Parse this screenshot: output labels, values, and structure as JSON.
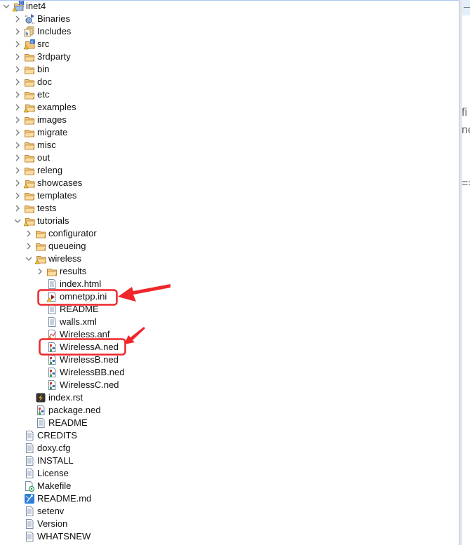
{
  "tree": [
    {
      "label": "inet4",
      "level": 0,
      "expander": "open",
      "icon": "project"
    },
    {
      "label": "Binaries",
      "level": 1,
      "expander": "closed",
      "icon": "binaries"
    },
    {
      "label": "Includes",
      "level": 1,
      "expander": "closed",
      "icon": "includes"
    },
    {
      "label": "src",
      "level": 1,
      "expander": "closed",
      "icon": "src-folder"
    },
    {
      "label": "3rdparty",
      "level": 1,
      "expander": "closed",
      "icon": "folder"
    },
    {
      "label": "bin",
      "level": 1,
      "expander": "closed",
      "icon": "folder"
    },
    {
      "label": "doc",
      "level": 1,
      "expander": "closed",
      "icon": "folder"
    },
    {
      "label": "etc",
      "level": 1,
      "expander": "closed",
      "icon": "folder"
    },
    {
      "label": "examples",
      "level": 1,
      "expander": "closed",
      "icon": "folder-warning"
    },
    {
      "label": "images",
      "level": 1,
      "expander": "closed",
      "icon": "folder"
    },
    {
      "label": "migrate",
      "level": 1,
      "expander": "closed",
      "icon": "folder"
    },
    {
      "label": "misc",
      "level": 1,
      "expander": "closed",
      "icon": "folder"
    },
    {
      "label": "out",
      "level": 1,
      "expander": "closed",
      "icon": "folder"
    },
    {
      "label": "releng",
      "level": 1,
      "expander": "closed",
      "icon": "folder"
    },
    {
      "label": "showcases",
      "level": 1,
      "expander": "closed",
      "icon": "folder-warning"
    },
    {
      "label": "templates",
      "level": 1,
      "expander": "closed",
      "icon": "folder"
    },
    {
      "label": "tests",
      "level": 1,
      "expander": "closed",
      "icon": "folder"
    },
    {
      "label": "tutorials",
      "level": 1,
      "expander": "open",
      "icon": "folder-warning"
    },
    {
      "label": "configurator",
      "level": 2,
      "expander": "closed",
      "icon": "folder"
    },
    {
      "label": "queueing",
      "level": 2,
      "expander": "closed",
      "icon": "folder"
    },
    {
      "label": "wireless",
      "level": 2,
      "expander": "open",
      "icon": "folder-warning"
    },
    {
      "label": "results",
      "level": 3,
      "expander": "closed",
      "icon": "folder"
    },
    {
      "label": "index.html",
      "level": 3,
      "expander": "none",
      "icon": "text-file"
    },
    {
      "label": "omnetpp.ini",
      "level": 3,
      "expander": "none",
      "icon": "ini-file",
      "highlighted": true
    },
    {
      "label": "README",
      "level": 3,
      "expander": "none",
      "icon": "text-file"
    },
    {
      "label": "walls.xml",
      "level": 3,
      "expander": "none",
      "icon": "text-file"
    },
    {
      "label": "Wireless.anf",
      "level": 3,
      "expander": "none",
      "icon": "anf-file"
    },
    {
      "label": "WirelessA.ned",
      "level": 3,
      "expander": "none",
      "icon": "ned-file",
      "highlighted": true
    },
    {
      "label": "WirelessB.ned",
      "level": 3,
      "expander": "none",
      "icon": "ned-file"
    },
    {
      "label": "WirelessBB.ned",
      "level": 3,
      "expander": "none",
      "icon": "ned-file"
    },
    {
      "label": "WirelessC.ned",
      "level": 3,
      "expander": "none",
      "icon": "ned-file"
    },
    {
      "label": "index.rst",
      "level": 2,
      "expander": "none",
      "icon": "rst-file"
    },
    {
      "label": "package.ned",
      "level": 2,
      "expander": "none",
      "icon": "ned-file"
    },
    {
      "label": "README",
      "level": 2,
      "expander": "none",
      "icon": "text-file"
    },
    {
      "label": "CREDITS",
      "level": 1,
      "expander": "none",
      "icon": "text-file"
    },
    {
      "label": "doxy.cfg",
      "level": 1,
      "expander": "none",
      "icon": "text-file"
    },
    {
      "label": "INSTALL",
      "level": 1,
      "expander": "none",
      "icon": "text-file"
    },
    {
      "label": "License",
      "level": 1,
      "expander": "none",
      "icon": "text-file"
    },
    {
      "label": "Makefile",
      "level": 1,
      "expander": "none",
      "icon": "makefile"
    },
    {
      "label": "README.md",
      "level": 1,
      "expander": "none",
      "icon": "markdown-file"
    },
    {
      "label": "setenv",
      "level": 1,
      "expander": "none",
      "icon": "text-file"
    },
    {
      "label": "Version",
      "level": 1,
      "expander": "none",
      "icon": "text-file"
    },
    {
      "label": "WHATSNEW",
      "level": 1,
      "expander": "none",
      "icon": "text-file"
    }
  ],
  "editor_fragments": [
    "fi",
    "ne",
    "=="
  ],
  "colors": {
    "annotation": "#f0262a",
    "folder": "#f4c77a",
    "selection_border": "#a9c9ef"
  }
}
